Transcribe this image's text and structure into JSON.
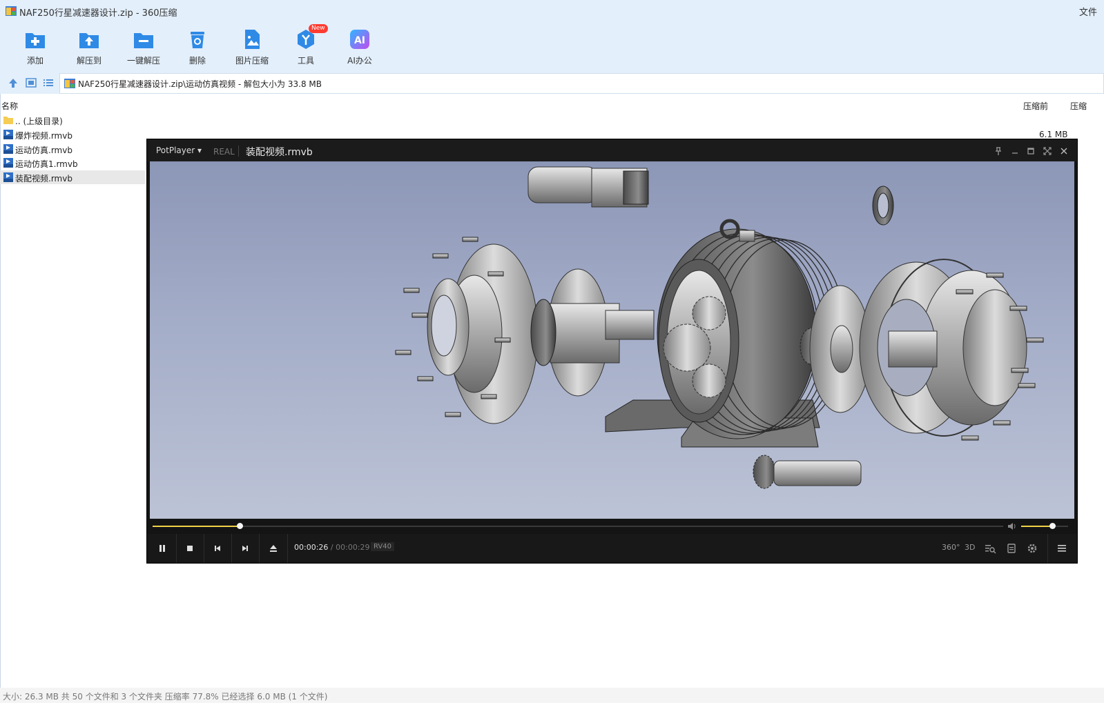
{
  "window": {
    "title": "NAF250行星减速器设计.zip - 360压缩",
    "right_label": "文件"
  },
  "toolbar": {
    "items": [
      {
        "label": "添加",
        "icon": "add-icon"
      },
      {
        "label": "解压到",
        "icon": "extract-to-icon"
      },
      {
        "label": "一键解压",
        "icon": "one-click-extract-icon"
      },
      {
        "label": "删除",
        "icon": "delete-icon"
      },
      {
        "label": "图片压缩",
        "icon": "image-compress-icon"
      },
      {
        "label": "工具",
        "icon": "tools-icon",
        "badge": "New"
      },
      {
        "label": "AI办公",
        "icon": "ai-office-icon"
      }
    ]
  },
  "address": {
    "path": "NAF250行星减速器设计.zip\\运动仿真视频 - 解包大小为 33.8 MB"
  },
  "columns": {
    "name": "名称",
    "before": "压缩前",
    "after": "压缩"
  },
  "files": [
    {
      "name": ".. (上级目录)",
      "type": "folder"
    },
    {
      "name": "爆炸视频.rmvb",
      "type": "rmvb"
    },
    {
      "name": "运动仿真.rmvb",
      "type": "rmvb"
    },
    {
      "name": "运动仿真1.rmvb",
      "type": "rmvb"
    },
    {
      "name": "装配视频.rmvb",
      "type": "rmvb",
      "selected": true
    }
  ],
  "visible_size": "6.1 MB",
  "statusbar": {
    "text": "大小: 26.3 MB 共 50 个文件和 3 个文件夹 压缩率 77.8% 已经选择 6.0 MB (1 个文件)"
  },
  "player": {
    "app_menu": "PotPlayer",
    "format": "REAL",
    "file": "装配视频.rmvb",
    "time_current": "00:00:26",
    "time_separator": "/",
    "time_total": "00:00:29",
    "codec": "RV40",
    "progress": 0.102,
    "volume": 0.66,
    "right_buttons": {
      "vr": "360°",
      "three_d": "3D"
    },
    "colors": {
      "seek": "#f2d24a",
      "bg": "#141414"
    }
  }
}
